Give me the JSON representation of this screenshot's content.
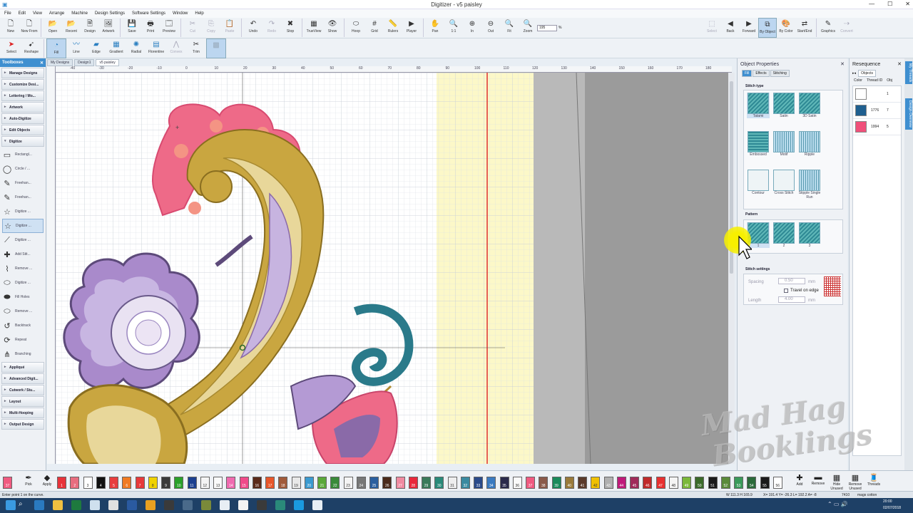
{
  "window": {
    "title": "Digitizer - v5 paisley",
    "min": "—",
    "max": "☐",
    "close": "✕"
  },
  "menu": [
    "File",
    "Edit",
    "View",
    "Arrange",
    "Machine",
    "Design Settings",
    "Software Settings",
    "Window",
    "Help"
  ],
  "toolbar1": [
    {
      "label": "New",
      "icon": "new-icon",
      "glyph": "🗋"
    },
    {
      "label": "New From",
      "icon": "new-from-icon",
      "glyph": "🗋"
    },
    {
      "label": "Open",
      "icon": "open-icon",
      "glyph": "📂"
    },
    {
      "label": "Recent",
      "icon": "recent-icon",
      "glyph": "📂"
    },
    {
      "label": "Design",
      "icon": "design-icon",
      "glyph": "🗎"
    },
    {
      "label": "Artwork",
      "icon": "artwork-icon",
      "glyph": "🖼"
    },
    {
      "label": "Save",
      "icon": "save-icon",
      "glyph": "💾"
    },
    {
      "label": "Print",
      "icon": "print-icon",
      "glyph": "🖶"
    },
    {
      "label": "Preview",
      "icon": "preview-icon",
      "glyph": "🗔"
    },
    {
      "label": "Cut",
      "icon": "cut-icon",
      "glyph": "✂",
      "disabled": true
    },
    {
      "label": "Copy",
      "icon": "copy-icon",
      "glyph": "⎘",
      "disabled": true
    },
    {
      "label": "Paste",
      "icon": "paste-icon",
      "glyph": "📋",
      "disabled": true
    },
    {
      "label": "Undo",
      "icon": "undo-icon",
      "glyph": "↶"
    },
    {
      "label": "Redo",
      "icon": "redo-icon",
      "glyph": "↷",
      "disabled": true
    },
    {
      "label": "Stop",
      "icon": "stop-icon",
      "glyph": "✖"
    },
    {
      "label": "TrueView",
      "icon": "trueview-icon",
      "glyph": "▦"
    },
    {
      "label": "Show",
      "icon": "show-icon",
      "glyph": "👁"
    },
    {
      "label": "Hoop",
      "icon": "hoop-icon",
      "glyph": "⬭"
    },
    {
      "label": "Grid",
      "icon": "grid-icon",
      "glyph": "#"
    },
    {
      "label": "Rulers",
      "icon": "rulers-icon",
      "glyph": "📏"
    },
    {
      "label": "Player",
      "icon": "player-icon",
      "glyph": "▶"
    },
    {
      "label": "Pan",
      "icon": "pan-icon",
      "glyph": "✋"
    },
    {
      "label": "1:1",
      "icon": "zoom-1to1-icon",
      "glyph": "🔍"
    },
    {
      "label": "In",
      "icon": "zoom-in-icon",
      "glyph": "⊕"
    },
    {
      "label": "Out",
      "icon": "zoom-out-icon",
      "glyph": "⊖"
    },
    {
      "label": "Fit",
      "icon": "zoom-fit-icon",
      "glyph": "🔍"
    },
    {
      "label": "Zoom",
      "icon": "zoom-icon",
      "glyph": "🔍"
    }
  ],
  "zoom": {
    "value": "195",
    "unit": "%"
  },
  "toolbar1_right": [
    {
      "label": "Select",
      "icon": "select-icon",
      "glyph": "⬚",
      "disabled": true
    },
    {
      "label": "Back",
      "icon": "back-icon",
      "glyph": "◀"
    },
    {
      "label": "Forward",
      "icon": "forward-icon",
      "glyph": "▶"
    },
    {
      "label": "By Object",
      "icon": "by-object-icon",
      "glyph": "⧉",
      "active": true
    },
    {
      "label": "By Color",
      "icon": "by-color-icon",
      "glyph": "🎨"
    },
    {
      "label": "Start/End",
      "icon": "start-end-icon",
      "glyph": "⇄"
    },
    {
      "label": "Graphics",
      "icon": "graphics-icon",
      "glyph": "✎"
    },
    {
      "label": "Convert",
      "icon": "convert-icon",
      "glyph": "⇢",
      "disabled": true
    }
  ],
  "toolbar2": [
    {
      "label": "Select",
      "icon": "select-arrow-icon",
      "glyph": "➤",
      "color": "#d22"
    },
    {
      "label": "Reshape",
      "icon": "reshape-icon",
      "glyph": "➹",
      "color": "#333"
    },
    {
      "label": "Fill",
      "icon": "fill-icon",
      "glyph": "◔",
      "color": "#2a7fc1",
      "active": true
    },
    {
      "label": "Line",
      "icon": "line-icon",
      "glyph": "〰",
      "color": "#2a7fc1"
    },
    {
      "label": "Edge",
      "icon": "edge-icon",
      "glyph": "▰",
      "color": "#2a7fc1"
    },
    {
      "label": "Gradient",
      "icon": "gradient-icon",
      "glyph": "▦",
      "color": "#2a7fc1"
    },
    {
      "label": "Radial",
      "icon": "radial-icon",
      "glyph": "✺",
      "color": "#2a7fc1"
    },
    {
      "label": "Florentine",
      "icon": "florentine-icon",
      "glyph": "▤",
      "color": "#2a7fc1"
    },
    {
      "label": "Convex",
      "icon": "convex-icon",
      "glyph": "⋀",
      "color": "#aab",
      "disabled": true
    },
    {
      "label": "Trim",
      "icon": "trim-icon",
      "glyph": "✂",
      "color": "#333"
    },
    {
      "label": "",
      "icon": "blank-tool-icon",
      "glyph": "▩",
      "color": "#9ab",
      "active": true
    }
  ],
  "toolboxes": {
    "title": "Toolboxes",
    "close": "✕",
    "sections_top": [
      "Manage Designs",
      "Customize Desi...",
      "Lettering / Mo...",
      "Artwork",
      "Auto-Digitize",
      "Edit Objects"
    ],
    "digitize": "Digitize",
    "items": [
      {
        "label": "Rectangl...",
        "icon": "rectangle-icon",
        "glyph": "▭"
      },
      {
        "label": "Circle / ...",
        "icon": "circle-icon",
        "glyph": "◯"
      },
      {
        "label": "Freehan...",
        "icon": "freehand-icon",
        "glyph": "✎"
      },
      {
        "label": "Freehan...",
        "icon": "freehand-open-icon",
        "glyph": "✎"
      },
      {
        "label": "Digitize ...",
        "icon": "digitize-star-icon",
        "glyph": "☆"
      },
      {
        "label": "Digitize ...",
        "icon": "digitize-star-selected-icon",
        "glyph": "☆",
        "selected": true
      },
      {
        "label": "Digitize ...",
        "icon": "digitize-shape-icon",
        "glyph": "⟋"
      },
      {
        "label": "Add Stit...",
        "icon": "add-stitch-icon",
        "glyph": "✚"
      },
      {
        "label": "Remove ...",
        "icon": "remove-icon",
        "glyph": "⌇"
      },
      {
        "label": "Digitize ...",
        "icon": "digitize-hole-icon",
        "glyph": "⬭"
      },
      {
        "label": "Fill Holes",
        "icon": "fill-holes-icon",
        "glyph": "⬬"
      },
      {
        "label": "Remove ...",
        "icon": "remove-holes-icon",
        "glyph": "⬭"
      },
      {
        "label": "Backtrack",
        "icon": "backtrack-icon",
        "glyph": "↺"
      },
      {
        "label": "Repeat",
        "icon": "repeat-icon",
        "glyph": "⟳"
      },
      {
        "label": "Branching",
        "icon": "branching-icon",
        "glyph": "⋔"
      }
    ],
    "sections_bottom": [
      "Appliqué",
      "Advanced Digit...",
      "Cutwork / Stu...",
      "Layout",
      "Multi-Hooping",
      "Output Design"
    ]
  },
  "doc_tabs": [
    "My Designs",
    "Design1",
    "v5 paisley"
  ],
  "ruler_top": [
    "-40",
    "-30",
    "-20",
    "-10",
    "0",
    "10",
    "20",
    "30",
    "40",
    "50",
    "60",
    "70",
    "80",
    "90",
    "100",
    "110",
    "120",
    "130",
    "140",
    "150",
    "160",
    "170",
    "180"
  ],
  "object_properties": {
    "title": "Object Properties",
    "close": "✕",
    "tabs": [
      "Fill",
      "Effects",
      "Stitching"
    ],
    "stitch_type_label": "Stitch type",
    "stitch_types": [
      "Tatami",
      "Satin",
      "3D Satin",
      "Embossed",
      "Motif",
      "Ripple",
      "Contour",
      "Cross Stitch",
      "Stipple Single Run"
    ],
    "pattern_label": "Pattern",
    "patterns": [
      "1",
      "2",
      "3"
    ],
    "settings_label": "Stitch settings",
    "spacing_label": "Spacing",
    "spacing_value": "0.50",
    "spacing_unit": "mm",
    "travel_label": "Travel on edge",
    "length_label": "Length",
    "length_value": "4.00",
    "length_unit": "mm"
  },
  "resequence": {
    "title": "Resequence",
    "close": "✕",
    "tab": "Objects",
    "headers": [
      "Color",
      "Thread ID",
      "Obj"
    ],
    "rows": [
      {
        "color": "#ffffff",
        "thread": "",
        "obj": "1"
      },
      {
        "color": "#1f5f8f",
        "thread": "1776",
        "obj": "7"
      },
      {
        "color": "#f0507a",
        "thread": "1994",
        "obj": "5"
      }
    ]
  },
  "side_tabs": [
    "My Threads",
    "Design Overview"
  ],
  "palette": {
    "current": "37",
    "tools": [
      {
        "label": "Pick",
        "icon": "pick-icon",
        "glyph": "✒"
      },
      {
        "label": "Apply",
        "icon": "apply-icon",
        "glyph": "◆"
      }
    ],
    "chips": [
      {
        "n": "1",
        "c": "#e8333a"
      },
      {
        "n": "2",
        "c": "#e86d7f"
      },
      {
        "n": "3",
        "c": "#ffffff"
      },
      {
        "n": "4",
        "c": "#111111"
      },
      {
        "n": "5",
        "c": "#e83e3e"
      },
      {
        "n": "6",
        "c": "#f07a22"
      },
      {
        "n": "7",
        "c": "#e8393a"
      },
      {
        "n": "8",
        "c": "#f0d200"
      },
      {
        "n": "9",
        "c": "#3a3a3a"
      },
      {
        "n": "10",
        "c": "#2aa02a"
      },
      {
        "n": "11",
        "c": "#1b3f8f"
      },
      {
        "n": "12",
        "c": "#f4f4f4"
      },
      {
        "n": "13",
        "c": "#fafafa"
      },
      {
        "n": "14",
        "c": "#f06ab0"
      },
      {
        "n": "15",
        "c": "#f04a8a"
      },
      {
        "n": "16",
        "c": "#5a2a1a"
      },
      {
        "n": "17",
        "c": "#e8562a"
      },
      {
        "n": "18",
        "c": "#a05a3a"
      },
      {
        "n": "19",
        "c": "#e8e8e8"
      },
      {
        "n": "20",
        "c": "#3a9ad0"
      },
      {
        "n": "21",
        "c": "#5aa83a"
      },
      {
        "n": "22",
        "c": "#3a8a3a"
      },
      {
        "n": "23",
        "c": "#f4f4f4"
      },
      {
        "n": "24",
        "c": "#777777"
      },
      {
        "n": "25",
        "c": "#2a5f9f"
      },
      {
        "n": "26",
        "c": "#4a2a1a"
      },
      {
        "n": "27",
        "c": "#f08aa0"
      },
      {
        "n": "28",
        "c": "#e8283a"
      },
      {
        "n": "29",
        "c": "#3a7a5a"
      },
      {
        "n": "30",
        "c": "#2a8a7a"
      },
      {
        "n": "31",
        "c": "#eeeeee"
      },
      {
        "n": "32",
        "c": "#3a8aa0"
      },
      {
        "n": "33",
        "c": "#2a4a8a"
      },
      {
        "n": "34",
        "c": "#3a7ac0"
      },
      {
        "n": "35",
        "c": "#2a2a4a"
      },
      {
        "n": "36",
        "c": "#fafafa"
      },
      {
        "n": "37",
        "c": "#f05a80"
      },
      {
        "n": "38",
        "c": "#8a5a4a"
      },
      {
        "n": "39",
        "c": "#1a8a5a"
      },
      {
        "n": "40",
        "c": "#9a7a3a"
      },
      {
        "n": "41",
        "c": "#5a3a2a"
      },
      {
        "n": "42",
        "c": "#f0c000"
      },
      {
        "n": "43",
        "c": "#b0b0b0"
      },
      {
        "n": "44",
        "c": "#c01a7a"
      },
      {
        "n": "45",
        "c": "#a02a5a"
      },
      {
        "n": "46",
        "c": "#c02a2a"
      },
      {
        "n": "47",
        "c": "#e83030"
      },
      {
        "n": "48",
        "c": "#f4f4f4"
      },
      {
        "n": "49",
        "c": "#7ab83a"
      },
      {
        "n": "50",
        "c": "#3a6a2a"
      },
      {
        "n": "51",
        "c": "#1a1a1a"
      },
      {
        "n": "52",
        "c": "#5a8a3a"
      },
      {
        "n": "53",
        "c": "#3a9a5a"
      },
      {
        "n": "54",
        "c": "#2a6a3a"
      },
      {
        "n": "55",
        "c": "#1a1a1a"
      },
      {
        "n": "56",
        "c": "#ffffff"
      }
    ],
    "actions": [
      {
        "label": "Add",
        "icon": "add-icon",
        "glyph": "✚"
      },
      {
        "label": "Remove",
        "icon": "remove-color-icon",
        "glyph": "▬"
      },
      {
        "label": "Hide Unused",
        "icon": "hide-unused-icon",
        "glyph": "▦"
      },
      {
        "label": "Remove Unused",
        "icon": "remove-unused-icon",
        "glyph": "▦"
      },
      {
        "label": "Threads",
        "icon": "threads-icon",
        "glyph": "🧵"
      }
    ]
  },
  "status": {
    "hint": "Enter point 1 on the curve.",
    "size": "W 111.3 H 165.9",
    "coords": "X= 191.4 Y= -26.3 L= 192.2 A= -8",
    "stitches": "7410",
    "thread": "mags cotton"
  },
  "taskbar": {
    "time": "20:00",
    "date": "02/07/2018",
    "apps": [
      {
        "icon": "windows-start-icon",
        "c": "#3a9ae0"
      },
      {
        "icon": "edge-browser-icon",
        "c": "#2a7ac0"
      },
      {
        "icon": "file-explorer-icon",
        "c": "#f0c040"
      },
      {
        "icon": "excel-icon",
        "c": "#1e7a3e"
      },
      {
        "icon": "notepad-icon",
        "c": "#cfe0ee"
      },
      {
        "icon": "chrome-app-icon",
        "c": "#e0e0e0"
      },
      {
        "icon": "word-icon",
        "c": "#2a5aa0"
      },
      {
        "icon": "chrome-icon",
        "c": "#e8a020"
      },
      {
        "icon": "media-icon",
        "c": "#3a3a3a"
      },
      {
        "icon": "photo-icon",
        "c": "#4a6a8a"
      },
      {
        "icon": "sketch-icon",
        "c": "#7a8a3a"
      },
      {
        "icon": "d-app-icon",
        "c": "#e8eef4"
      },
      {
        "icon": "panda-icon",
        "c": "#f4f4f4"
      },
      {
        "icon": "game-icon",
        "c": "#3a3a3a"
      },
      {
        "icon": "c-app-icon",
        "c": "#2a8a7a"
      },
      {
        "icon": "skype-icon",
        "c": "#1a9ae0"
      },
      {
        "icon": "d-app2-icon",
        "c": "#e8eef4"
      }
    ]
  },
  "watermark": {
    "line1": "Mad Hag",
    "line2": "Booklings"
  }
}
